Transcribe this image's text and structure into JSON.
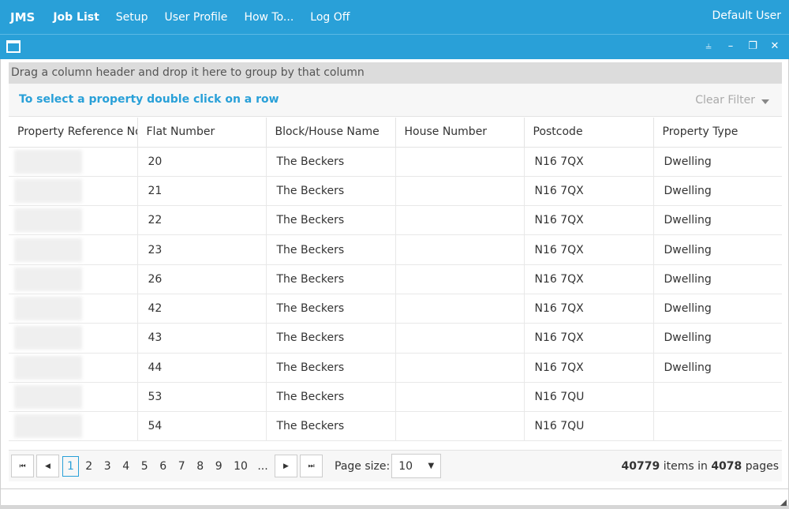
{
  "nav": {
    "brand": "JMS",
    "items": [
      "Job List",
      "Setup",
      "User Profile",
      "How To...",
      "Log Off"
    ],
    "active": "Job List",
    "user": "Default User"
  },
  "window": {
    "controls": [
      "pin-icon",
      "minimize-icon",
      "restore-icon",
      "close-icon"
    ]
  },
  "grid": {
    "group_hint": "Drag a column header and drop it here to group by that column",
    "instruction": "To select a property double click on a row",
    "clear_filter": "Clear Filter",
    "columns": [
      "Property Reference No",
      "Flat Number",
      "Block/House Name",
      "House Number",
      "Postcode",
      "Property Type"
    ],
    "rows": [
      {
        "flat": "20",
        "block": "The Beckers",
        "house": "",
        "postcode": "N16 7QX",
        "type": "Dwelling"
      },
      {
        "flat": "21",
        "block": "The Beckers",
        "house": "",
        "postcode": "N16 7QX",
        "type": "Dwelling"
      },
      {
        "flat": "22",
        "block": "The Beckers",
        "house": "",
        "postcode": "N16 7QX",
        "type": "Dwelling"
      },
      {
        "flat": "23",
        "block": "The Beckers",
        "house": "",
        "postcode": "N16 7QX",
        "type": "Dwelling"
      },
      {
        "flat": "26",
        "block": "The Beckers",
        "house": "",
        "postcode": "N16 7QX",
        "type": "Dwelling"
      },
      {
        "flat": "42",
        "block": "The Beckers",
        "house": "",
        "postcode": "N16 7QX",
        "type": "Dwelling"
      },
      {
        "flat": "43",
        "block": "The Beckers",
        "house": "",
        "postcode": "N16 7QX",
        "type": "Dwelling"
      },
      {
        "flat": "44",
        "block": "The Beckers",
        "house": "",
        "postcode": "N16 7QX",
        "type": "Dwelling"
      },
      {
        "flat": "53",
        "block": "The Beckers",
        "house": "",
        "postcode": "N16 7QU",
        "type": ""
      },
      {
        "flat": "54",
        "block": "The Beckers",
        "house": "",
        "postcode": "N16 7QU",
        "type": ""
      }
    ]
  },
  "pager": {
    "pages": [
      "1",
      "2",
      "3",
      "4",
      "5",
      "6",
      "7",
      "8",
      "9",
      "10",
      "..."
    ],
    "current": "1",
    "page_size_label": "Page size:",
    "page_size": "10",
    "total_items": "40779",
    "items_in_label": "items in",
    "total_pages": "4078",
    "pages_label": "pages"
  },
  "colors": {
    "accent": "#29a0d8",
    "header_bg": "#29a0d8"
  }
}
